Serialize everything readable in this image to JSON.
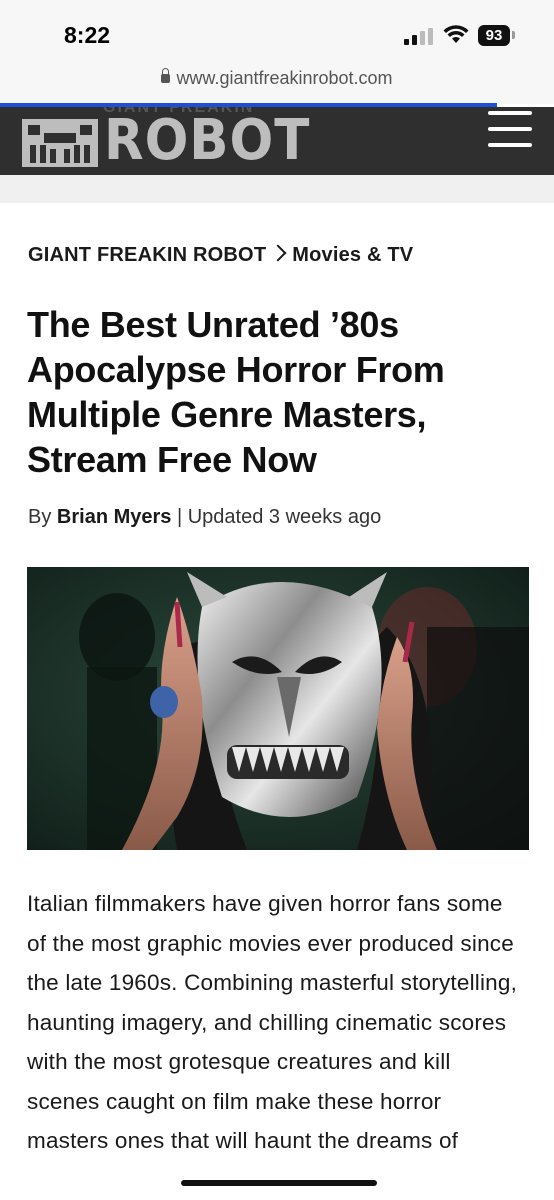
{
  "status_bar": {
    "time": "8:22",
    "battery": "93"
  },
  "browser": {
    "url": "www.giantfreakinrobot.com"
  },
  "site": {
    "logo_text": "ROBOT",
    "logo_top_text": "GIANT FREAKIN"
  },
  "breadcrumb": {
    "home": "GIANT FREAKIN ROBOT",
    "section": "Movies & TV"
  },
  "article": {
    "title": "The Best Unrated ’80s Apocalypse Horror From Multiple Genre Masters, Stream Free Now",
    "byline_prefix": "By",
    "author": "Brian Myers",
    "byline_separator": "|",
    "updated": "Updated 3 weeks ago",
    "body": "Italian filmmakers have given horror fans some of the most graphic movies ever produced since the late 1960s. Combining masterful storytelling, haunting imagery, and chilling cinematic scores with the most grotesque creatures and kill scenes caught on film make these horror masters ones that will haunt the dreams of"
  },
  "colors": {
    "progress": "#1e4fd6",
    "header_bg": "#2f2f2f",
    "logo": "#bdbdbd"
  },
  "icons": [
    "signal-icon",
    "wifi-icon",
    "battery-icon",
    "lock-icon",
    "menu-icon",
    "logo-icon"
  ]
}
